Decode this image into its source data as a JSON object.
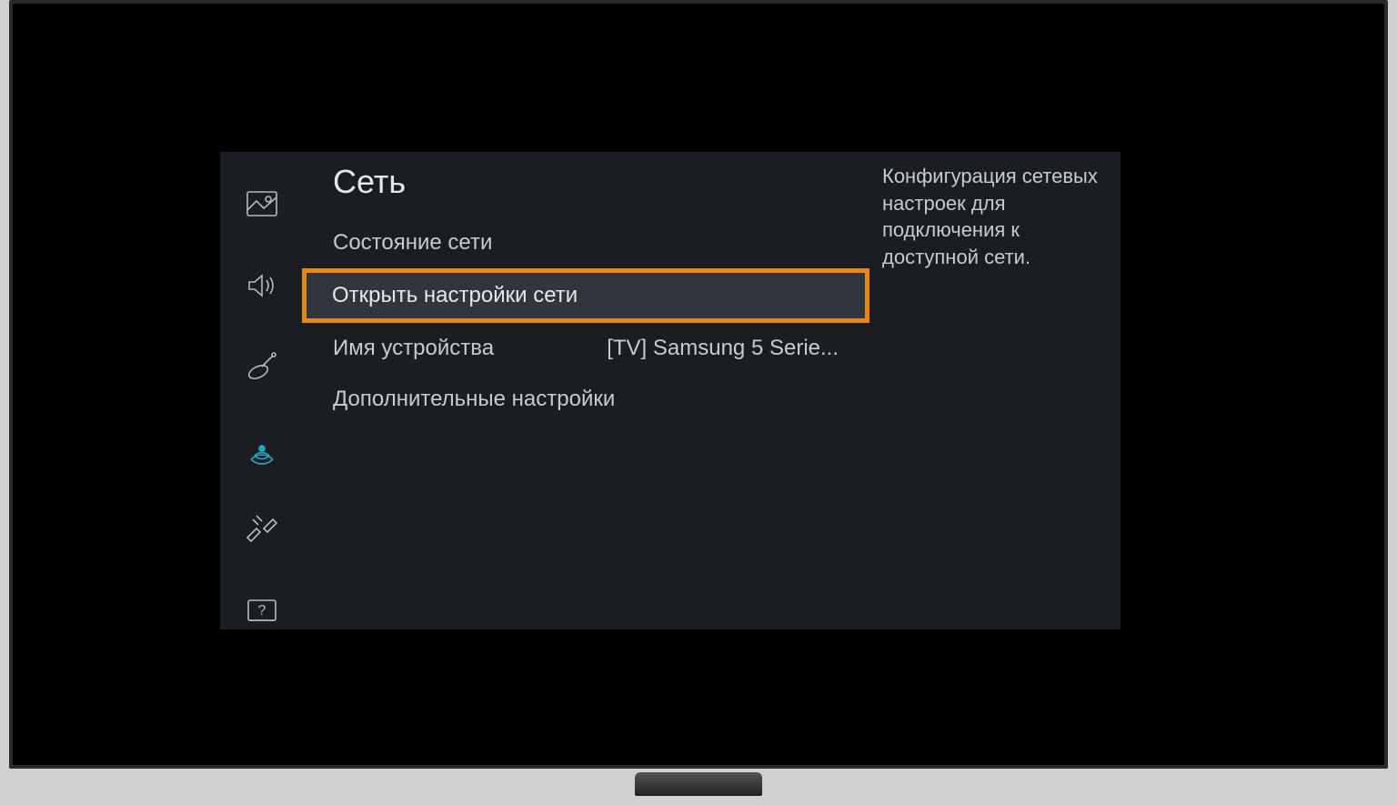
{
  "section_title": "Сеть",
  "menu": {
    "items": [
      {
        "label": "Состояние сети",
        "value": "",
        "selected": false
      },
      {
        "label": "Открыть настройки сети",
        "value": "",
        "selected": true
      },
      {
        "label": "Имя устройства",
        "value": "[TV] Samsung 5 Serie...",
        "selected": false
      },
      {
        "label": "Дополнительные настройки",
        "value": "",
        "selected": false
      }
    ]
  },
  "description": "Конфигурация сетевых настроек для подключения к доступной сети.",
  "sidebar_icons": [
    {
      "name": "picture-icon",
      "active": false
    },
    {
      "name": "sound-icon",
      "active": false
    },
    {
      "name": "broadcast-icon",
      "active": false
    },
    {
      "name": "network-icon",
      "active": true
    },
    {
      "name": "system-icon",
      "active": false
    },
    {
      "name": "support-icon",
      "active": false
    }
  ],
  "colors": {
    "accent": "#24a6c9",
    "highlight_border": "#e58a1a",
    "panel_bg": "#1a1d21"
  }
}
